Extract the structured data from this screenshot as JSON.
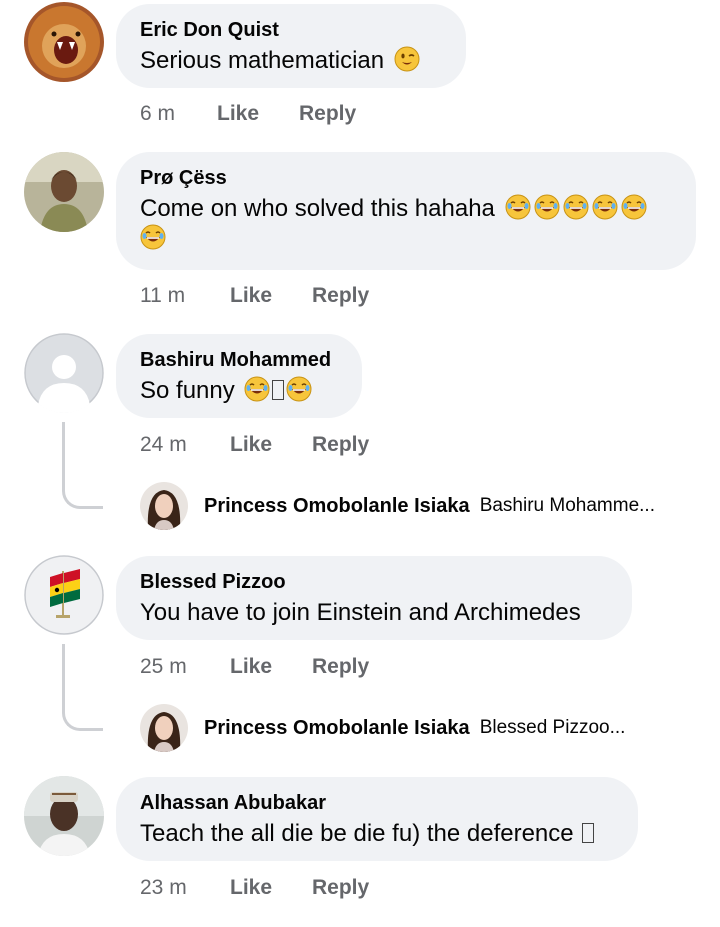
{
  "comments": [
    {
      "author": "Eric Don Quist",
      "text": "Serious mathematician",
      "time": "6 m",
      "like_label": "Like",
      "reply_label": "Reply",
      "avatar": "lion-avatar",
      "emojis": [
        "winking-face"
      ]
    },
    {
      "author": "Prø Çëss",
      "text": "Come on who solved this hahaha",
      "time": "11 m",
      "like_label": "Like",
      "reply_label": "Reply",
      "avatar": "person-photo-avatar",
      "emojis": [
        "tears-of-joy",
        "tears-of-joy",
        "tears-of-joy",
        "tears-of-joy",
        "tears-of-joy",
        "tears-of-joy"
      ]
    },
    {
      "author": "Bashiru Mohammed",
      "text": "So funny",
      "time": "24 m",
      "like_label": "Like",
      "reply_label": "Reply",
      "avatar": "default-avatar",
      "emojis": [
        "tears-of-joy",
        "missing-glyph",
        "tears-of-joy"
      ],
      "reply_preview": {
        "author": "Princess Omobolanle Isiaka",
        "text": "Bashiru Mohamme..."
      }
    },
    {
      "author": "Blessed Pizzoo",
      "text": "You have to join Einstein and Archimedes",
      "time": "25 m",
      "like_label": "Like",
      "reply_label": "Reply",
      "avatar": "ghana-flag-avatar",
      "reply_preview": {
        "author": "Princess Omobolanle Isiaka",
        "text": "Blessed Pizzoo..."
      }
    },
    {
      "author": "Alhassan Abubakar",
      "text": "Teach the all die be die fu) the deference",
      "time": "23 m",
      "like_label": "Like",
      "reply_label": "Reply",
      "avatar": "person-cap-avatar",
      "emojis": [
        "missing-glyph"
      ]
    }
  ],
  "colors": {
    "bubble": "#f0f2f5",
    "meta": "#65676b",
    "thread_line": "#ced0d4"
  }
}
